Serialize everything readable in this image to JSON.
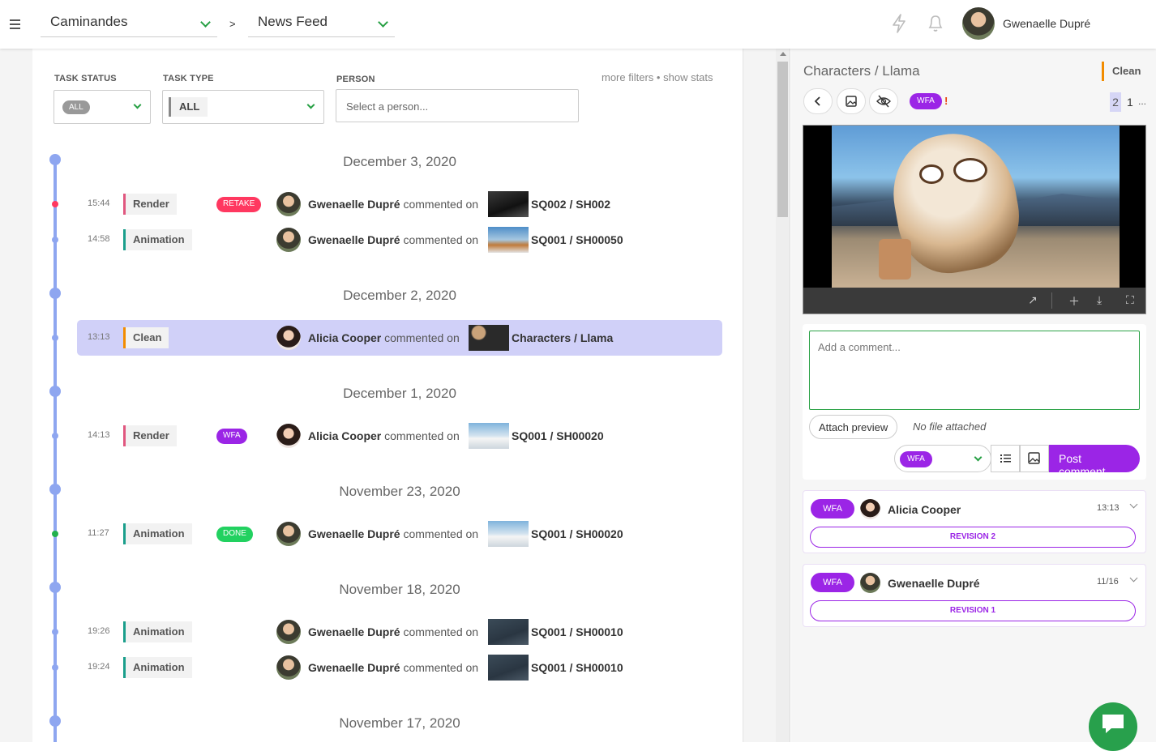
{
  "topbar": {
    "production": "Caminandes",
    "separator": ">",
    "section": "News Feed",
    "user_name": "Gwenaelle Dupré"
  },
  "filters": {
    "task_status_label": "TASK STATUS",
    "task_status_value": "ALL",
    "task_type_label": "TASK TYPE",
    "task_type_value": "ALL",
    "person_label": "PERSON",
    "person_placeholder": "Select a person...",
    "more_filters": "more filters",
    "bullet": "•",
    "show_stats": "show stats"
  },
  "feed": {
    "commented_on": "commented on",
    "dates": [
      "December 3, 2020",
      "December 2, 2020",
      "December 1, 2020",
      "November 23, 2020",
      "November 18, 2020",
      "November 17, 2020"
    ],
    "rows": [
      {
        "time": "15:44",
        "task_type": "Render",
        "type_color": "#e0577f",
        "status": "RETAKE",
        "status_color": "#ff3860",
        "person": "Gwenaelle Dupré",
        "target": "SQ002 / SH002",
        "dot": "#ff3860"
      },
      {
        "time": "14:58",
        "task_type": "Animation",
        "type_color": "#1a9e8b",
        "status": "",
        "status_color": "",
        "person": "Gwenaelle Dupré",
        "target": "SQ001 / SH00050",
        "dot": ""
      },
      {
        "time": "13:13",
        "task_type": "Clean",
        "type_color": "#f28c00",
        "status": "",
        "status_color": "",
        "person": "Alicia Cooper",
        "target": "Characters / Llama",
        "dot": ""
      },
      {
        "time": "14:13",
        "task_type": "Render",
        "type_color": "#e0577f",
        "status": "WFA",
        "status_color": "#9b25e6",
        "person": "Alicia Cooper",
        "target": "SQ001 / SH00020",
        "dot": ""
      },
      {
        "time": "11:27",
        "task_type": "Animation",
        "type_color": "#1a9e8b",
        "status": "DONE",
        "status_color": "#22d160",
        "person": "Gwenaelle Dupré",
        "target": "SQ001 / SH00020",
        "dot": "#22b14c"
      },
      {
        "time": "19:26",
        "task_type": "Animation",
        "type_color": "#1a9e8b",
        "status": "",
        "status_color": "",
        "person": "Gwenaelle Dupré",
        "target": "SQ001 / SH00010",
        "dot": ""
      },
      {
        "time": "19:24",
        "task_type": "Animation",
        "type_color": "#1a9e8b",
        "status": "",
        "status_color": "",
        "person": "Gwenaelle Dupré",
        "target": "SQ001 / SH00010",
        "dot": ""
      }
    ]
  },
  "panel": {
    "title": "Characters / Llama",
    "task_type": "Clean",
    "status": "WFA",
    "alert": "!",
    "revision_current": "2",
    "revision_other": "1",
    "revision_more": "...",
    "comment_placeholder": "Add a comment...",
    "attach_label": "Attach preview",
    "no_file": "No file attached",
    "status_select": "WFA",
    "post_label": "Post comment",
    "comments": [
      {
        "status": "WFA",
        "author": "Alicia Cooper",
        "date": "13:13",
        "revision": "REVISION 2"
      },
      {
        "status": "WFA",
        "author": "Gwenaelle Dupré",
        "date": "11/16",
        "revision": "REVISION 1"
      }
    ]
  },
  "colors": {
    "accent": "#9b25e6",
    "green": "#27a044",
    "timeline": "#8ea6f0",
    "highlight": "#d0d0f8"
  }
}
